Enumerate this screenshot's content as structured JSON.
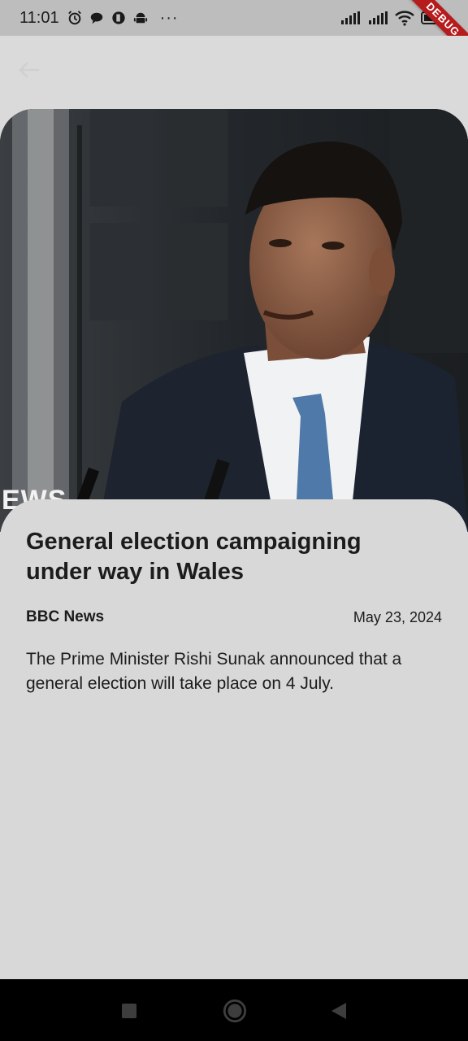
{
  "status_bar": {
    "time": "11:01",
    "icons_left": [
      "alarm-icon",
      "chat-icon",
      "app-icon",
      "android-icon"
    ],
    "more": "···",
    "icons_right": [
      "signal-icon",
      "signal-icon",
      "wifi-icon",
      "battery-icon"
    ]
  },
  "debug_banner": "DEBUG",
  "article": {
    "image_caption_fragment": "EWS",
    "title": "General election campaigning under way in Wales",
    "source": "BBC News",
    "date": "May 23, 2024",
    "description": "The Prime Minister Rishi Sunak announced that a general election will take place on 4 July."
  },
  "nav_bar": {
    "buttons": [
      "recents-icon",
      "home-icon",
      "back-icon"
    ]
  }
}
